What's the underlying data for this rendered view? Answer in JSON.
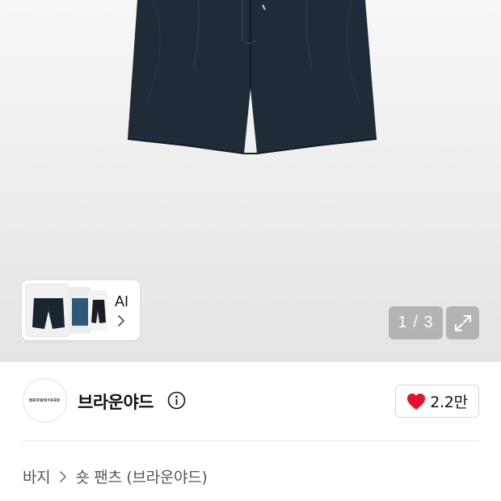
{
  "gallery": {
    "ai_label": "AI",
    "counter": "1 / 3",
    "current": 1,
    "total": 3,
    "colors": {
      "product": "#1e2a35",
      "thumb_blue": "#2d5877"
    }
  },
  "brand": {
    "logo_text": "BROWNYARD",
    "name": "브라운야드"
  },
  "like": {
    "count": "2.2만",
    "heart_color": "#e8112d"
  },
  "breadcrumb": {
    "items": [
      "바지",
      "숏 팬츠 (브라운야드)"
    ]
  }
}
